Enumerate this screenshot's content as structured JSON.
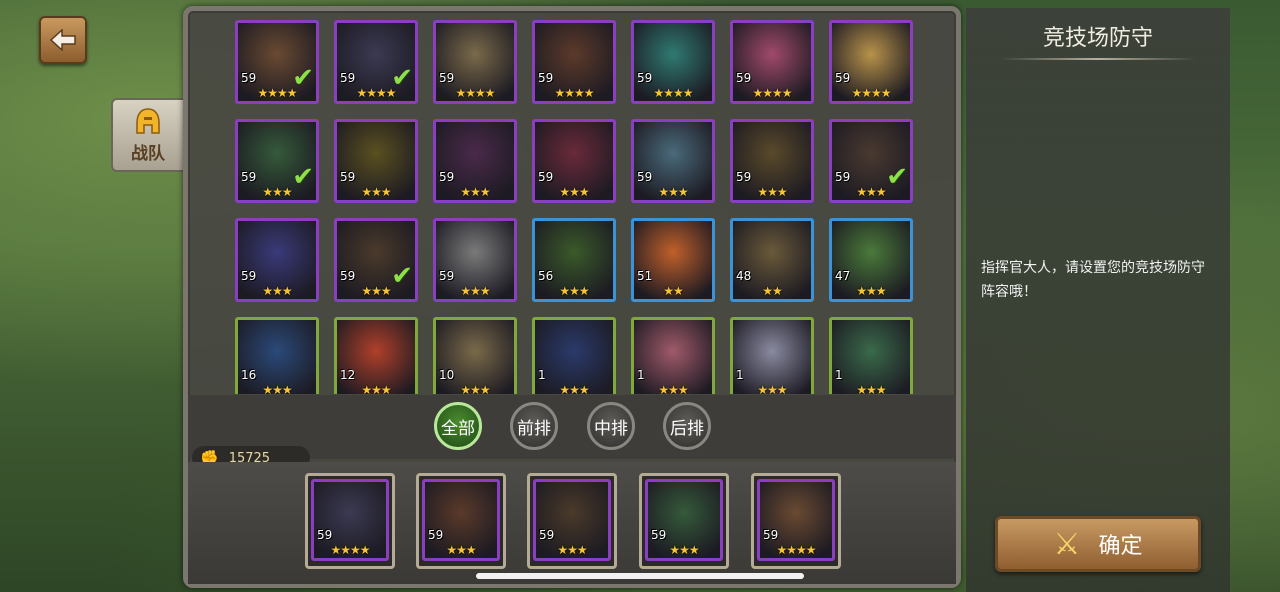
{
  "nav": {
    "back_icon": "back-arrow-icon",
    "team_tab_label": "战队",
    "team_tab_icon": "helmet-icon"
  },
  "roster": {
    "rows": [
      [
        {
          "level": "59",
          "stars": 4,
          "max_stars": 4,
          "selected": true,
          "frame": "purple",
          "art": "#6a4a32"
        },
        {
          "level": "59",
          "stars": 4,
          "max_stars": 4,
          "selected": true,
          "frame": "purple",
          "art": "#3b3a52"
        },
        {
          "level": "59",
          "stars": 4,
          "max_stars": 4,
          "selected": false,
          "frame": "purple",
          "art": "#7a6a4a"
        },
        {
          "level": "59",
          "stars": 4,
          "max_stars": 4,
          "selected": false,
          "frame": "purple",
          "art": "#5c3a2a"
        },
        {
          "level": "59",
          "stars": 4,
          "max_stars": 4,
          "selected": false,
          "frame": "purple",
          "art": "#2f7a72"
        },
        {
          "level": "59",
          "stars": 4,
          "max_stars": 4,
          "selected": false,
          "frame": "purple",
          "art": "#a04a6a"
        },
        {
          "level": "59",
          "stars": 4,
          "max_stars": 4,
          "selected": false,
          "frame": "purple",
          "art": "#b8924a"
        }
      ],
      [
        {
          "level": "59",
          "stars": 3,
          "max_stars": 3,
          "selected": true,
          "frame": "purple",
          "art": "#355a3a"
        },
        {
          "level": "59",
          "stars": 3,
          "max_stars": 3,
          "selected": false,
          "frame": "purple",
          "art": "#5a5020"
        },
        {
          "level": "59",
          "stars": 3,
          "max_stars": 3,
          "selected": false,
          "frame": "purple",
          "art": "#4a2a4a"
        },
        {
          "level": "59",
          "stars": 3,
          "max_stars": 3,
          "selected": false,
          "frame": "purple",
          "art": "#6a2a3a"
        },
        {
          "level": "59",
          "stars": 3,
          "max_stars": 3,
          "selected": false,
          "frame": "purple",
          "art": "#4a6a7a"
        },
        {
          "level": "59",
          "stars": 3,
          "max_stars": 3,
          "selected": false,
          "frame": "purple",
          "art": "#5a4a2a"
        },
        {
          "level": "59",
          "stars": 3,
          "max_stars": 3,
          "selected": true,
          "frame": "purple",
          "art": "#4a3a30"
        }
      ],
      [
        {
          "level": "59",
          "stars": 3,
          "max_stars": 3,
          "selected": false,
          "frame": "purple",
          "art": "#3a3a7a"
        },
        {
          "level": "59",
          "stars": 3,
          "max_stars": 3,
          "selected": true,
          "frame": "purple",
          "art": "#4a3a2a"
        },
        {
          "level": "59",
          "stars": 3,
          "max_stars": 3,
          "selected": false,
          "frame": "purple",
          "art": "#7a7a7a"
        },
        {
          "level": "56",
          "stars": 3,
          "max_stars": 3,
          "selected": false,
          "frame": "blue",
          "art": "#3a5a2a"
        },
        {
          "level": "51",
          "stars": 2,
          "max_stars": 2,
          "selected": false,
          "frame": "blue",
          "art": "#c0602a"
        },
        {
          "level": "48",
          "stars": 2,
          "max_stars": 2,
          "selected": false,
          "frame": "blue",
          "art": "#6a5a3a"
        },
        {
          "level": "47",
          "stars": 3,
          "max_stars": 3,
          "selected": false,
          "frame": "blue",
          "art": "#4a7a3a"
        }
      ],
      [
        {
          "level": "16",
          "stars": 3,
          "max_stars": 3,
          "selected": false,
          "frame": "green",
          "art": "#2a4a7a"
        },
        {
          "level": "12",
          "stars": 3,
          "max_stars": 3,
          "selected": false,
          "frame": "green",
          "art": "#b0402a"
        },
        {
          "level": "10",
          "stars": 3,
          "max_stars": 3,
          "selected": false,
          "frame": "green",
          "art": "#7a6a4a"
        },
        {
          "level": "1",
          "stars": 3,
          "max_stars": 3,
          "selected": false,
          "frame": "green",
          "art": "#2a3a6a"
        },
        {
          "level": "1",
          "stars": 3,
          "max_stars": 3,
          "selected": false,
          "frame": "green",
          "art": "#a05a6a"
        },
        {
          "level": "1",
          "stars": 3,
          "max_stars": 3,
          "selected": false,
          "frame": "green",
          "art": "#8a8aa0"
        },
        {
          "level": "1",
          "stars": 3,
          "max_stars": 3,
          "selected": false,
          "frame": "green",
          "art": "#3a6a4a"
        }
      ]
    ]
  },
  "filters": [
    {
      "label": "全部",
      "active": true
    },
    {
      "label": "前排",
      "active": false
    },
    {
      "label": "中排",
      "active": false
    },
    {
      "label": "后排",
      "active": false
    }
  ],
  "power": {
    "icon": "fist-icon",
    "value": "15725"
  },
  "team": [
    {
      "level": "59",
      "stars": 4,
      "frame": "purple",
      "art": "#3b3a52"
    },
    {
      "level": "59",
      "stars": 3,
      "frame": "purple",
      "art": "#5a3a2a"
    },
    {
      "level": "59",
      "stars": 3,
      "frame": "purple",
      "art": "#4a3a2a"
    },
    {
      "level": "59",
      "stars": 3,
      "frame": "purple",
      "art": "#355a3a"
    },
    {
      "level": "59",
      "stars": 4,
      "frame": "purple",
      "art": "#6a4a32"
    }
  ],
  "side": {
    "title": "竞技场防守",
    "description": "指挥官大人，请设置您的竞技场防守阵容哦！",
    "confirm_label": "确定",
    "confirm_icon": "crossed-swords-icon"
  },
  "colors": {
    "star": "#f7c531",
    "check": "#8ee04a",
    "frame_purple": "#8a3fc0",
    "frame_blue": "#3c92d6",
    "frame_green": "#7fa93a"
  }
}
